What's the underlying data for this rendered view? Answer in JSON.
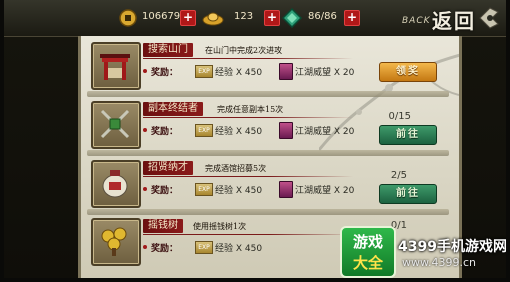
{
  "top_bar": {
    "coins": "1066791",
    "gold": "123",
    "jade": "86/86",
    "back_en": "BACK",
    "back_cn": "返回"
  },
  "quests": [
    {
      "name": "搜索山门",
      "desc": "在山门中完成2次进攻",
      "reward_label": "奖励：",
      "exp_badge": "EXP",
      "exp": "经验 X 450",
      "fame": "江湖威望 X 20",
      "progress": "",
      "button": "领奖",
      "button_type": "claim"
    },
    {
      "name": "副本终结者",
      "desc": "完成任意副本15次",
      "reward_label": "奖励：",
      "exp_badge": "EXP",
      "exp": "经验 X 450",
      "fame": "江湖威望 X 20",
      "progress": "0/15",
      "button": "前往",
      "button_type": "goto"
    },
    {
      "name": "招贤纳才",
      "desc": "完成酒馆招募5次",
      "reward_label": "奖励：",
      "exp_badge": "EXP",
      "exp": "经验 X 450",
      "fame": "江湖威望 X 20",
      "progress": "2/5",
      "button": "前往",
      "button_type": "goto"
    },
    {
      "name": "摇钱树",
      "desc": "使用摇钱树1次",
      "reward_label": "奖励：",
      "exp_badge": "EXP",
      "exp": "经验 X 450",
      "fame": "",
      "progress": "0/1",
      "button": "",
      "button_type": ""
    }
  ],
  "watermark": {
    "logo_line1": "游戏",
    "logo_line2": "大全",
    "text": "4399手机游戏网",
    "url": "www.4399.cn"
  },
  "icons": {
    "coin": "coin-icon",
    "gold": "gold-ingot-icon",
    "jade": "jade-icon",
    "back": "back-arrow-icon"
  }
}
